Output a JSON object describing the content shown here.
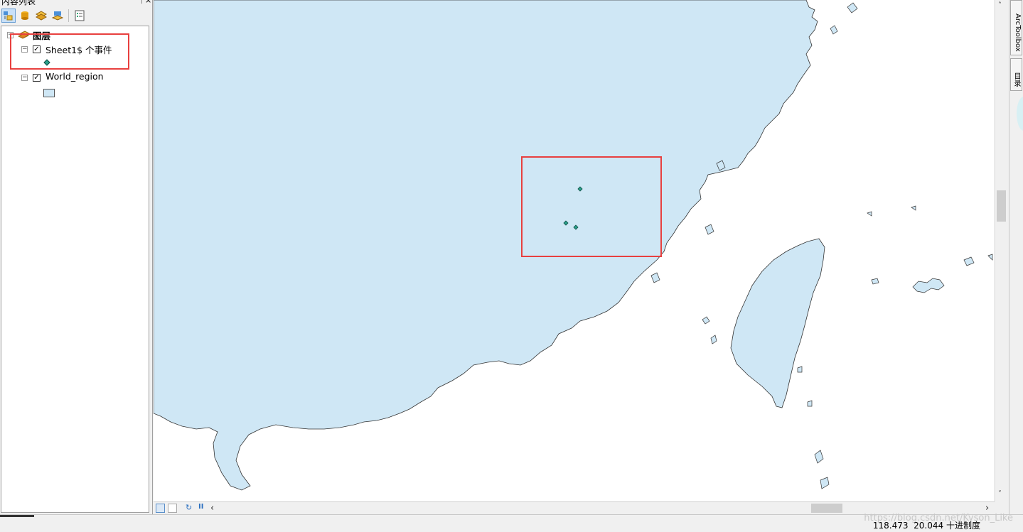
{
  "toc": {
    "title": "内容列表",
    "pin_icon": "pin-icon",
    "close_icon": "close-icon",
    "root_label": "图层",
    "layers": [
      {
        "label": "Sheet1$ 个事件",
        "checked": true,
        "symbol": "point"
      },
      {
        "label": "World_region",
        "checked": true,
        "symbol": "polygon"
      }
    ]
  },
  "side_tabs": {
    "arctoolbox": "ArcToolbox",
    "catalog": "目录"
  },
  "status": {
    "x": "118.473",
    "y": "20.044",
    "units": "十进制度",
    "watermark": "https://blog.csdn.net/Kyson_Like"
  },
  "colors": {
    "land": "#cfe7f5",
    "highlight": "#e8403f",
    "point": "#2aa08a"
  }
}
